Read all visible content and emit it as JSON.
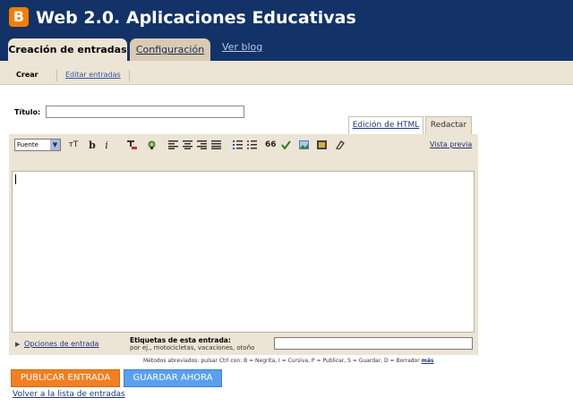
{
  "header": {
    "logo_letter": "B",
    "blog_title": "Web 2.0. Aplicaciones Educativas",
    "tabs": [
      {
        "label": "Creación de entradas"
      },
      {
        "label": "Configuración"
      }
    ],
    "view_blog_label": "Ver blog"
  },
  "subnav": {
    "items": [
      {
        "label": "Crear"
      },
      {
        "label": "Editar entradas"
      }
    ]
  },
  "post": {
    "title_label": "Título:",
    "title_value": ""
  },
  "editor": {
    "modes": [
      "Edición de HTML",
      "Redactar"
    ],
    "font_select_value": "Fuente",
    "toolbar_icons": [
      "font-size-icon",
      "bold-icon",
      "italic-icon",
      "text-color-icon",
      "insert-link-icon",
      "align-left-icon",
      "align-center-icon",
      "align-right-icon",
      "justify-icon",
      "numbered-list-icon",
      "bullet-list-icon",
      "blockquote-icon",
      "spellcheck-icon",
      "insert-image-icon",
      "insert-video-icon",
      "remove-format-icon"
    ],
    "toolbar_glyphs": {
      "bold": "b",
      "italic": "i",
      "font_size": "тT",
      "quote": "66"
    },
    "preview_label": "Vista previa",
    "body_text": ""
  },
  "footer": {
    "options_label": "Opciones de entrada",
    "labels_title": "Etiquetas de esta entrada:",
    "labels_example": "por ej., motocicletas, vacaciones, otoño",
    "labels_value": "",
    "shortcuts_text": "Métodos abreviados: pulsar Ctrl con: B = Negrita, I = Cursiva, P = Publicar, S = Guardar, D = Borrador",
    "shortcuts_more": "más",
    "publish_label": "PUBLICAR ENTRADA",
    "save_label": "GUARDAR AHORA",
    "back_label": "Volver a la lista de entradas"
  },
  "colors": {
    "header_bg": "#123268",
    "tab_bg": "#ece4d4",
    "publish_orange": "#f27f21",
    "save_blue": "#5aa0f0",
    "logo_orange": "#f57d00"
  }
}
